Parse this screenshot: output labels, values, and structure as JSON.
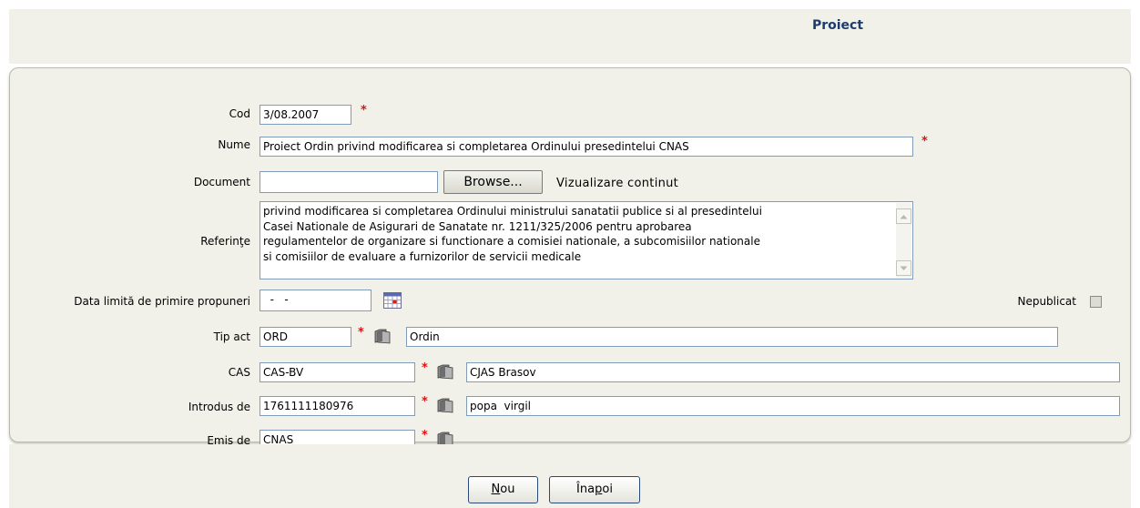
{
  "page": {
    "title": "Proiect"
  },
  "form": {
    "cod": {
      "label": "Cod",
      "value": "3/08.2007"
    },
    "nume": {
      "label": "Nume",
      "value": "Proiect Ordin privind modificarea si completarea Ordinului presedintelui CNAS"
    },
    "document": {
      "label": "Document",
      "value": "",
      "browse_label": "Browse...",
      "view_label": "Vizualizare continut"
    },
    "referinte": {
      "label": "Referinţe",
      "lines": [
        "privind modificarea si completarea Ordinului ministrului sanatatii publice si al presedintelui",
        "Casei Nationale de Asigurari de Sanatate nr. 1211/325/2006 pentru aprobarea",
        "regulamentelor de organizare si functionare a comisiei nationale, a subcomisiilor nationale",
        "si comisiilor de evaluare a furnizorilor de servicii medicale"
      ]
    },
    "data_limita": {
      "label": "Data limită de primire propuneri",
      "value": "  -   -"
    },
    "nepublicat": {
      "label": "Nepublicat",
      "checked": false
    },
    "tip_act": {
      "label": "Tip act",
      "code": "ORD",
      "name": "Ordin"
    },
    "cas": {
      "label": "CAS",
      "code": "CAS-BV",
      "name": "CJAS Brasov"
    },
    "introdus_de": {
      "label": "Introdus de",
      "code": "1761111180976",
      "name": "popa  virgil"
    },
    "emis_de": {
      "label": "Emis de",
      "code": "CNAS"
    },
    "required_mark": "*"
  },
  "buttons": {
    "nou": {
      "accel": "N",
      "rest": "ou"
    },
    "inapoi": {
      "pre": "Îna",
      "accel": "p",
      "rest": "oi"
    }
  },
  "colors": {
    "title": "#1c3c6e",
    "panel": "#f1f1e9",
    "required": "#e21010",
    "input_border": "#7f9db9"
  },
  "icons": {
    "lookup": "folder-icon",
    "calendar": "calendar-icon",
    "scroll_up": "arrow-up-icon",
    "scroll_down": "arrow-down-icon"
  }
}
